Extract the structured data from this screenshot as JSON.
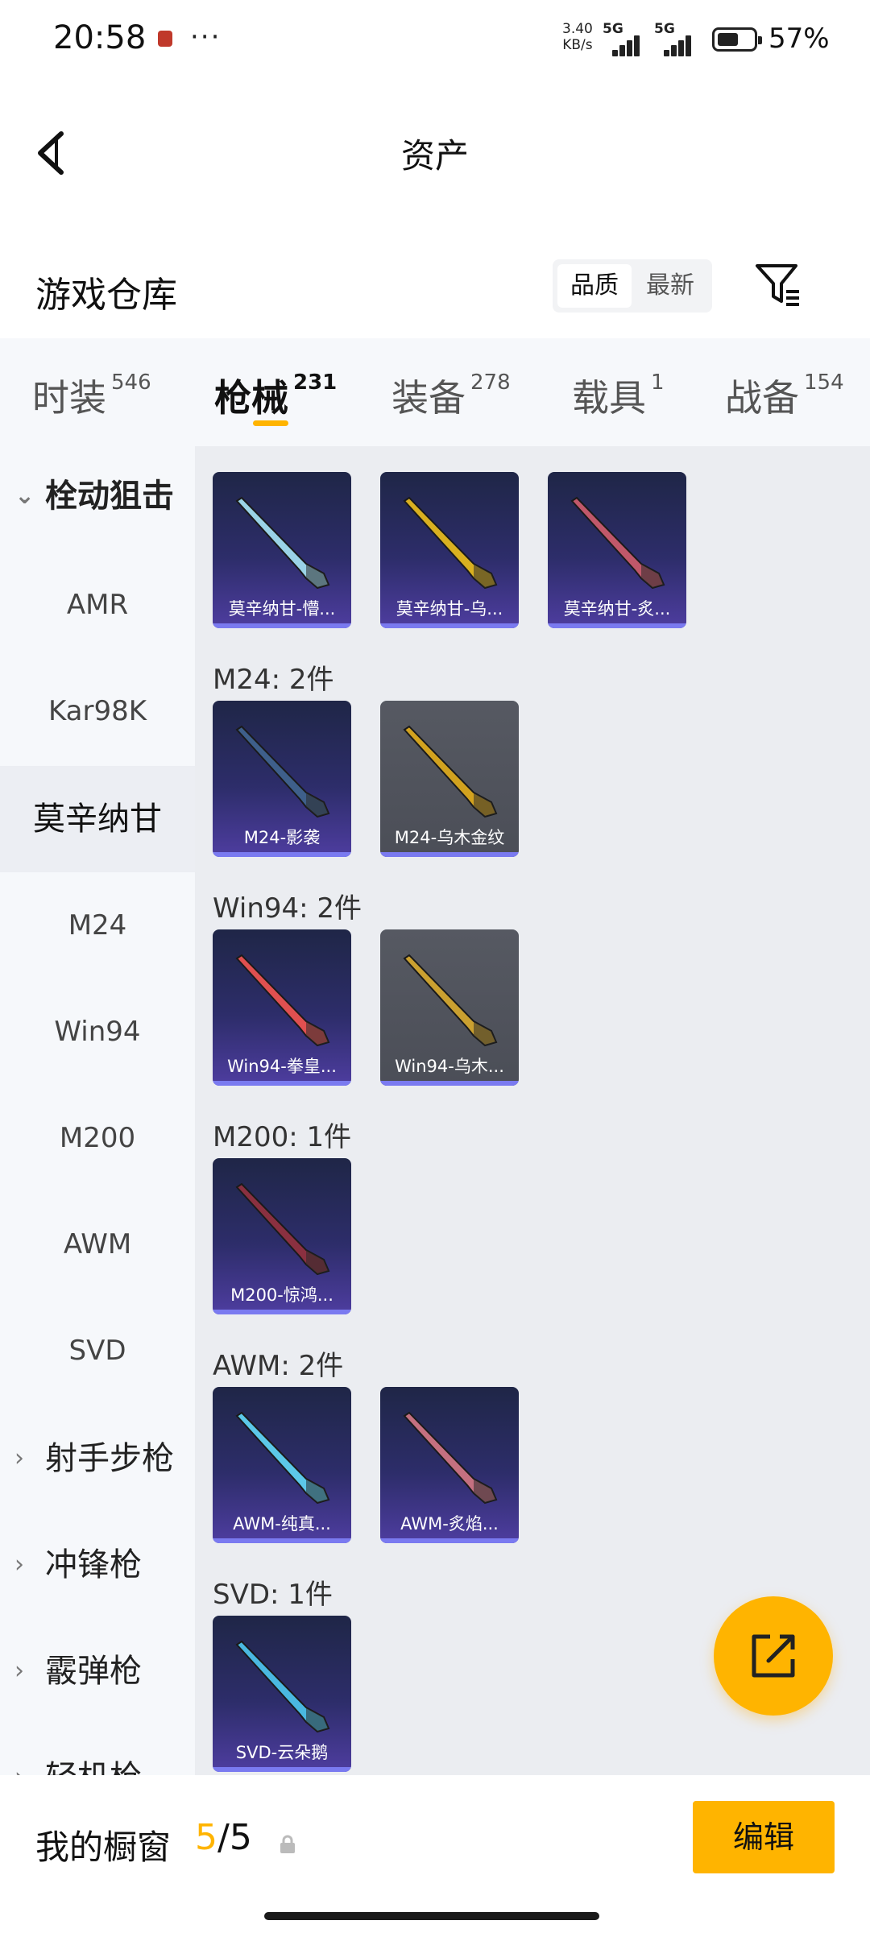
{
  "status_bar": {
    "time": "20:58",
    "dots": "···",
    "speed_value": "3.40",
    "speed_unit": "KB/s",
    "signal1": "5G",
    "signal2": "5G",
    "battery": "57%",
    "battery_level": 0.57
  },
  "header": {
    "title": "资产"
  },
  "section": {
    "title": "游戏仓库",
    "sort_options": [
      "品质",
      "最新"
    ],
    "sort_active": "品质"
  },
  "tabs": [
    {
      "label": "时装",
      "count": "546"
    },
    {
      "label": "枪械",
      "count": "231"
    },
    {
      "label": "装备",
      "count": "278"
    },
    {
      "label": "载具",
      "count": "1"
    },
    {
      "label": "战备",
      "count": "154"
    }
  ],
  "sidebar": [
    {
      "label": "栓动狙击",
      "type": "group",
      "expanded": true
    },
    {
      "label": "AMR"
    },
    {
      "label": "Kar98K"
    },
    {
      "label": "莫辛纳甘",
      "active": true
    },
    {
      "label": "M24"
    },
    {
      "label": "Win94"
    },
    {
      "label": "M200"
    },
    {
      "label": "AWM"
    },
    {
      "label": "SVD"
    },
    {
      "label": "射手步枪",
      "type": "group"
    },
    {
      "label": "冲锋枪",
      "type": "group"
    },
    {
      "label": "霰弹枪",
      "type": "group"
    },
    {
      "label": "轻机枪",
      "type": "group"
    }
  ],
  "groups": [
    {
      "label": "",
      "items": [
        {
          "name": "莫辛纳甘-懵...",
          "style": "purple",
          "gun": "#9ad3e6"
        },
        {
          "name": "莫辛纳甘-乌...",
          "style": "purple",
          "gun": "#d9b020"
        },
        {
          "name": "莫辛纳甘-炙...",
          "style": "purple",
          "gun": "#c0586a"
        }
      ]
    },
    {
      "label": "M24: 2件",
      "items": [
        {
          "name": "M24-影袭",
          "style": "purple",
          "gun": "#3e5f8a"
        },
        {
          "name": "M24-乌木金纹",
          "style": "gray",
          "gun": "#d2a21f"
        }
      ]
    },
    {
      "label": "Win94: 2件",
      "items": [
        {
          "name": "Win94-拳皇...",
          "style": "purple",
          "gun": "#e05050"
        },
        {
          "name": "Win94-乌木...",
          "style": "gray",
          "gun": "#caa030"
        }
      ]
    },
    {
      "label": "M200: 1件",
      "items": [
        {
          "name": "M200-惊鸿...",
          "style": "purple",
          "gun": "#8a3040"
        }
      ]
    },
    {
      "label": "AWM: 2件",
      "items": [
        {
          "name": "AWM-纯真...",
          "style": "purple",
          "gun": "#5cc8e8"
        },
        {
          "name": "AWM-炙焰...",
          "style": "purple",
          "gun": "#c47080"
        }
      ]
    },
    {
      "label": "SVD: 1件",
      "items": [
        {
          "name": "SVD-云朵鹅",
          "style": "purple",
          "gun": "#4ab8e0"
        }
      ]
    }
  ],
  "bottom": {
    "showcase_label": "我的橱窗",
    "current": "5",
    "separator": "/",
    "total": "5",
    "edit_label": "编辑"
  },
  "colors": {
    "accent": "#ffb400",
    "card_purple": "#2d2d6a",
    "card_gray": "#4b4e57"
  }
}
